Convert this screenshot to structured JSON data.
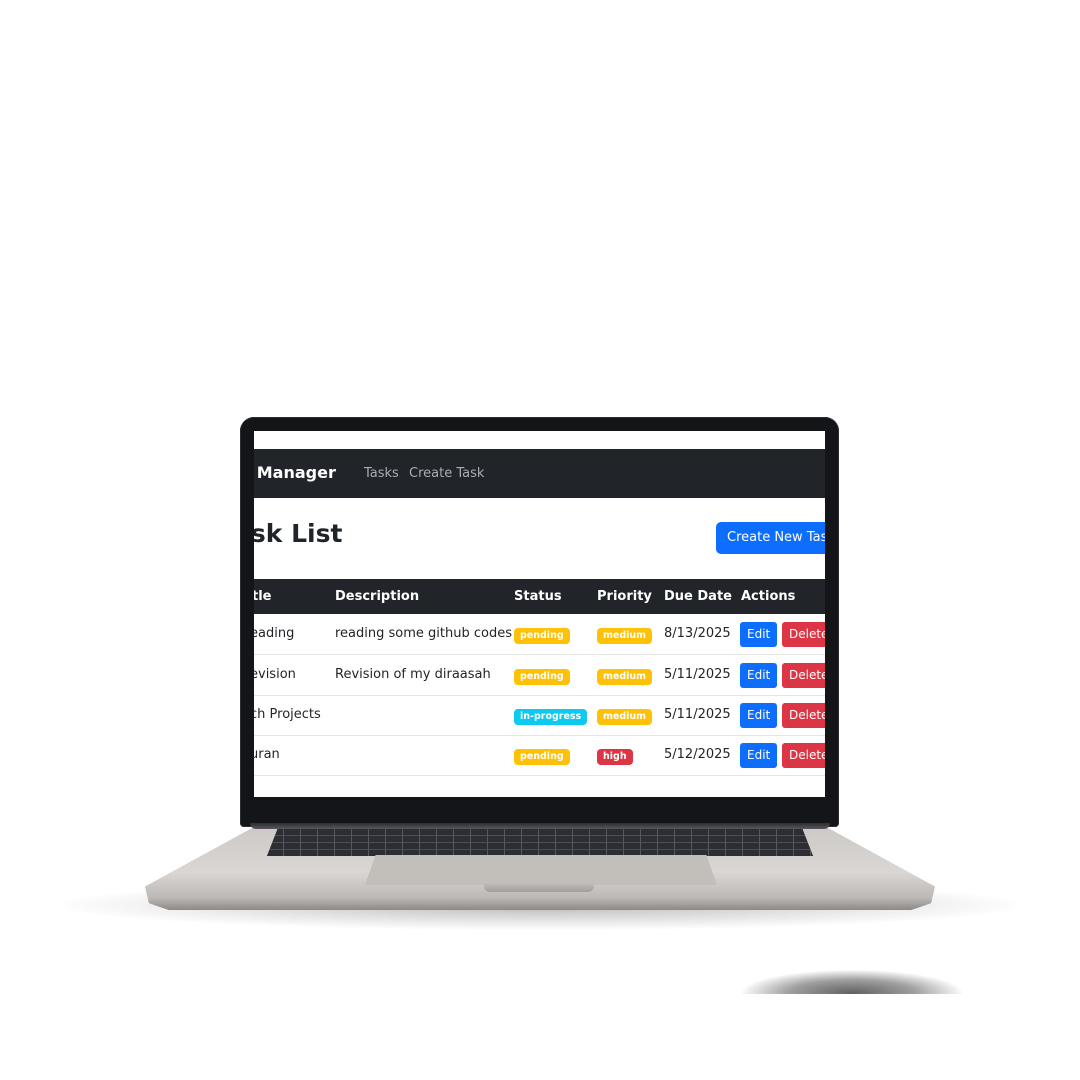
{
  "app": {
    "brand": "sk Manager",
    "nav": [
      "Tasks",
      "Create Task"
    ]
  },
  "page": {
    "title": "ask List",
    "create_button": "Create New Task"
  },
  "table": {
    "columns": [
      "tle",
      "Description",
      "Status",
      "Priority",
      "Due Date",
      "Actions"
    ],
    "rows": [
      {
        "title": "eading",
        "description": "reading some github codes",
        "status": "pending",
        "priority": "medium",
        "due": "8/13/2025",
        "edit": "Edit",
        "delete": "Delete"
      },
      {
        "title": "evision",
        "description": "Revision of my diraasah",
        "status": "pending",
        "priority": "medium",
        "due": "5/11/2025",
        "edit": "Edit",
        "delete": "Delete"
      },
      {
        "title": "ch Projects",
        "description": "",
        "status": "in-progress",
        "priority": "medium",
        "due": "5/11/2025",
        "edit": "Edit",
        "delete": "Delete"
      },
      {
        "title": "uran",
        "description": "",
        "status": "pending",
        "priority": "high",
        "due": "5/12/2025",
        "edit": "Edit",
        "delete": "Delete"
      }
    ]
  },
  "colors": {
    "navbar": "#212529",
    "primary": "#0d6efd",
    "danger": "#dc3545",
    "warning": "#ffc107",
    "info": "#0dcaf0"
  }
}
